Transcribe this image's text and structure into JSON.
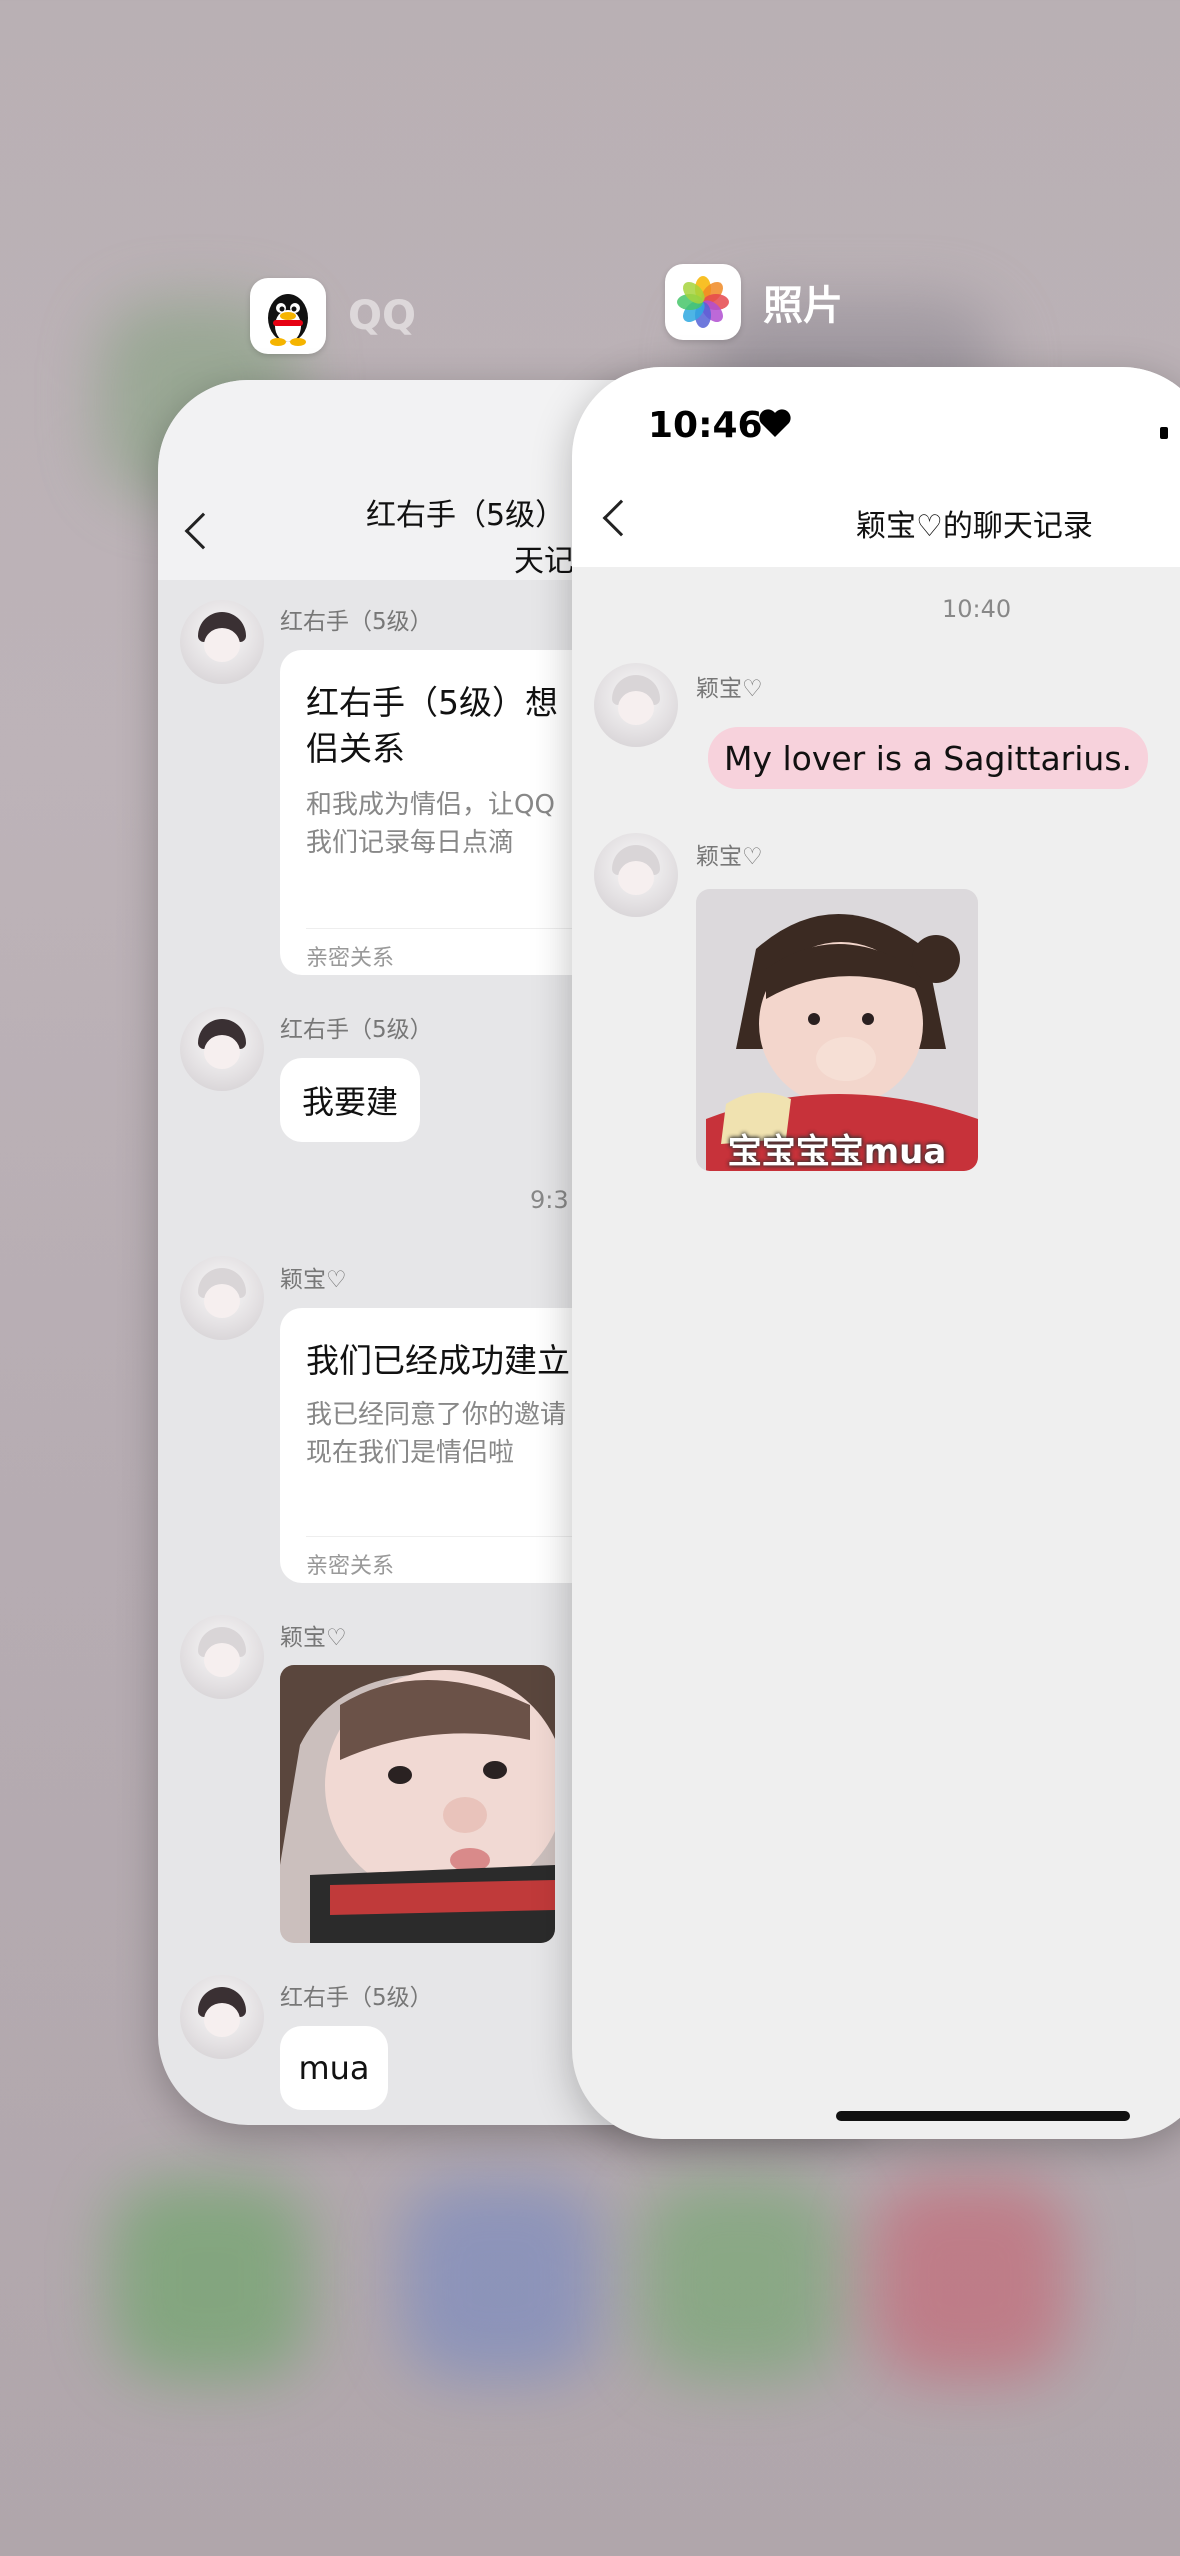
{
  "background_colors": {
    "bg": "#b9b0b4",
    "pink_bubble": "#f7d2dc"
  },
  "qq_app": {
    "icon": "qq-penguin-icon",
    "name": "QQ",
    "chat": {
      "title_line1": "红右手（5级）",
      "title_line2": "天记",
      "messages": [
        {
          "sender": "红右手（5级）",
          "card_title": "红右手（5级）想",
          "card_title2": "侣关系",
          "card_body1": "和我成为情侣，让QQ",
          "card_body2": "我们记录每日点滴",
          "card_footer": "亲密关系"
        },
        {
          "sender": "红右手（5级）",
          "text": "我要建"
        },
        {
          "time": "9:3"
        },
        {
          "sender": "颖宝♡",
          "card_title": "我们已经成功建立",
          "card_body1": "我已经同意了你的邀请",
          "card_body2": "现在我们是情侣啦",
          "card_footer": "亲密关系"
        },
        {
          "sender": "颖宝♡",
          "image": "baby-photo"
        },
        {
          "sender": "红右手（5级）",
          "text": "mua"
        }
      ]
    }
  },
  "photos_app": {
    "icon": "photos-flower-icon",
    "name": "照片",
    "status_time": "10:46",
    "status_icon": "heart-icon",
    "chat": {
      "title": "颖宝♡的聊天记录",
      "time": "10:40",
      "messages": [
        {
          "sender": "颖宝♡",
          "text": "My lover is a Sagittarius."
        },
        {
          "sender": "颖宝♡",
          "sticker_caption": "宝宝宝宝mua"
        }
      ]
    }
  }
}
